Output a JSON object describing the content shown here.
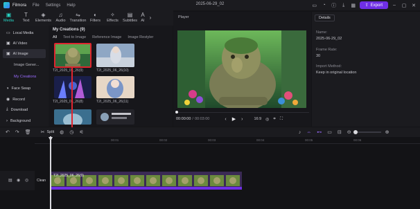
{
  "app": {
    "name": "Filmora",
    "menus": [
      "File",
      "Settings",
      "Help"
    ],
    "project_title": "2025-06-29_02",
    "export_label": "Export"
  },
  "toolbar": {
    "tools": [
      {
        "label": "Media",
        "icon": "media-icon"
      },
      {
        "label": "Text",
        "icon": "text-icon"
      },
      {
        "label": "Elements",
        "icon": "elements-icon"
      },
      {
        "label": "Audio",
        "icon": "audio-icon"
      },
      {
        "label": "Transition",
        "icon": "transition-icon"
      },
      {
        "label": "Filters",
        "icon": "filters-icon"
      },
      {
        "label": "Effects",
        "icon": "effects-icon"
      },
      {
        "label": "Subtitles",
        "icon": "subtitles-icon"
      },
      {
        "label": "AI",
        "icon": "ai-icon"
      }
    ]
  },
  "sidebar": {
    "items": [
      "Local Media",
      "AI Video",
      "AI Image",
      "Face Swap",
      "Record",
      "Download",
      "Background"
    ],
    "sub_items": [
      "Image Gener...",
      "My Creations"
    ]
  },
  "media": {
    "title": "My Creations (9)",
    "tabs": [
      "All",
      "Text to Image",
      "Reference Image",
      "Image Restyler"
    ],
    "thumb_labels": [
      "T2I_2025_06_26(9)",
      "T2I_2025_06_26(10)",
      "T2I_2025_06_26(8)",
      "T2I_2025_06_26(11)"
    ]
  },
  "player": {
    "header": "Player",
    "time_current": "00:00:00",
    "time_total": "00:03:00",
    "aspect": "16:9"
  },
  "details": {
    "tab": "Details",
    "name_label": "Name:",
    "name_value": "2025-06-29_02",
    "frame_rate_label": "Frame Rate:",
    "frame_rate_value": "30",
    "import_label": "Import Method:",
    "import_value": "Keep in original location"
  },
  "timeline": {
    "split_label": "Split",
    "ruler": [
      "00:01",
      "00:02",
      "00:03",
      "00:04",
      "00:05",
      "00:06",
      "00:07",
      "00:08"
    ],
    "clip_label": "T2I_2025_06_26(9)",
    "track_name": "Clean"
  },
  "colors": {
    "accent": "#27d4c4",
    "export": "#6f2fe6",
    "annotation": "#e0252f",
    "clip": "#3a2a54"
  }
}
